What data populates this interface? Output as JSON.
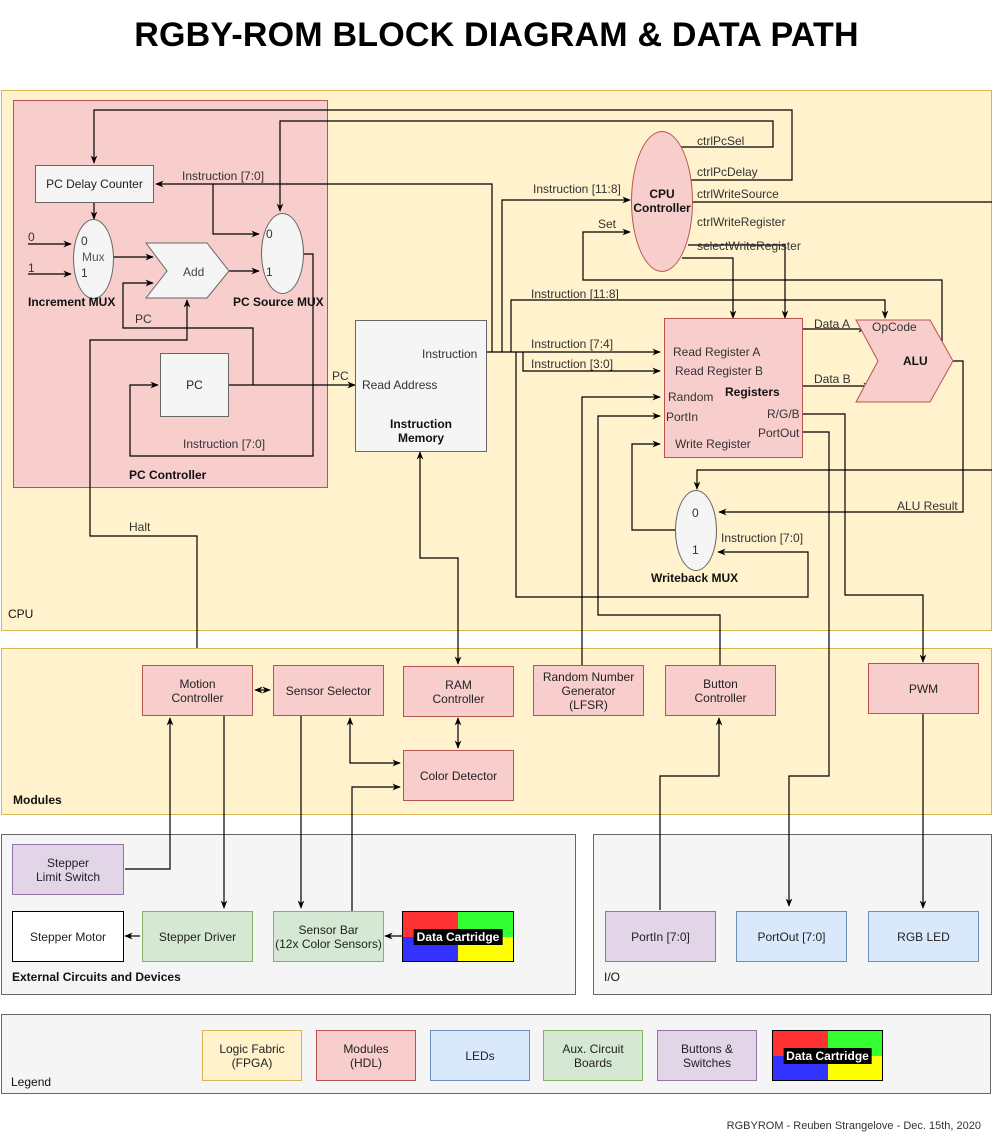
{
  "title": "RGBY-ROM BLOCK DIAGRAM & DATA PATH",
  "footer": "RGBYROM - Reuben Strangelove - Dec. 15th, 2020",
  "colors": {
    "logic_fabric": "#fff2cc",
    "modules": "#f8cecc",
    "leds": "#dae8fc",
    "aux_boards": "#d5e8d4",
    "buttons_switches": "#e1d5e7",
    "cartridge_red": "#ff3333",
    "cartridge_green": "#33ff33",
    "cartridge_blue": "#3333ff",
    "cartridge_yellow": "#ffff00"
  },
  "cpu": {
    "label": "CPU",
    "pc_controller": {
      "label": "PC Controller",
      "pc_delay_counter": "PC Delay Counter",
      "increment_mux": {
        "label": "Increment MUX",
        "in0": "0",
        "in1": "1",
        "mux": "Mux",
        "src0": "0",
        "src1": "1"
      },
      "adder": "Add",
      "pc_source_mux": {
        "label": "PC Source MUX",
        "in0": "0",
        "in1": "1"
      },
      "pc": "PC",
      "wire_instr_top": "Instruction [7:0]",
      "wire_pc": "PC",
      "wire_instr_bottom": "Instruction [7:0]"
    },
    "instruction_memory": {
      "title": "Instruction\nMemory",
      "read_address": "Read Address",
      "instruction": "Instruction",
      "wire_pc": "PC"
    },
    "cpu_controller": {
      "label": "CPU\nController",
      "in_instruction": "Instruction [11:8]",
      "in_set": "Set",
      "outputs": [
        "ctrlPcSel",
        "ctrlPcDelay",
        "ctrlWriteSource",
        "ctrlWriteRegister",
        "selectWriteRegister"
      ]
    },
    "registers": {
      "title": "Registers",
      "inputs": [
        "Read Register A",
        "Read Register B",
        "Random",
        "PortIn",
        "Write Register"
      ],
      "outputs": [
        "R/G/B",
        "PortOut"
      ],
      "wire_instr_a": "Instruction [7:4]",
      "wire_instr_b": "Instruction [3:0]",
      "wire_opcode": "Instruction [11:8]"
    },
    "alu": {
      "label": "ALU",
      "opcode": "OpCode",
      "data_a": "Data A",
      "data_b": "Data B",
      "result": "ALU Result"
    },
    "writeback_mux": {
      "label": "Writeback MUX",
      "in0": "0",
      "in1": "1",
      "wire_instr": "Instruction [7:0]"
    },
    "halt": "Halt"
  },
  "modules": {
    "label": "Modules",
    "items": [
      "Motion\nController",
      "Sensor Selector",
      "RAM\nController",
      "Random Number\nGenerator\n(LFSR)",
      "Button\nController",
      "PWM",
      "Color Detector"
    ]
  },
  "external": {
    "label": "External Circuits and Devices",
    "items": [
      "Stepper\nLimit Switch",
      "Stepper Motor",
      "Stepper Driver",
      "Sensor Bar\n(12x Color Sensors)"
    ],
    "cartridge": "Data Cartridge"
  },
  "io": {
    "label": "I/O",
    "items": [
      "PortIn [7:0]",
      "PortOut [7:0]",
      "RGB LED"
    ]
  },
  "legend": {
    "label": "Legend",
    "items": [
      "Logic Fabric\n(FPGA)",
      "Modules\n(HDL)",
      "LEDs",
      "Aux. Circuit\nBoards",
      "Buttons &\nSwitches"
    ],
    "cartridge": "Data Cartridge"
  }
}
